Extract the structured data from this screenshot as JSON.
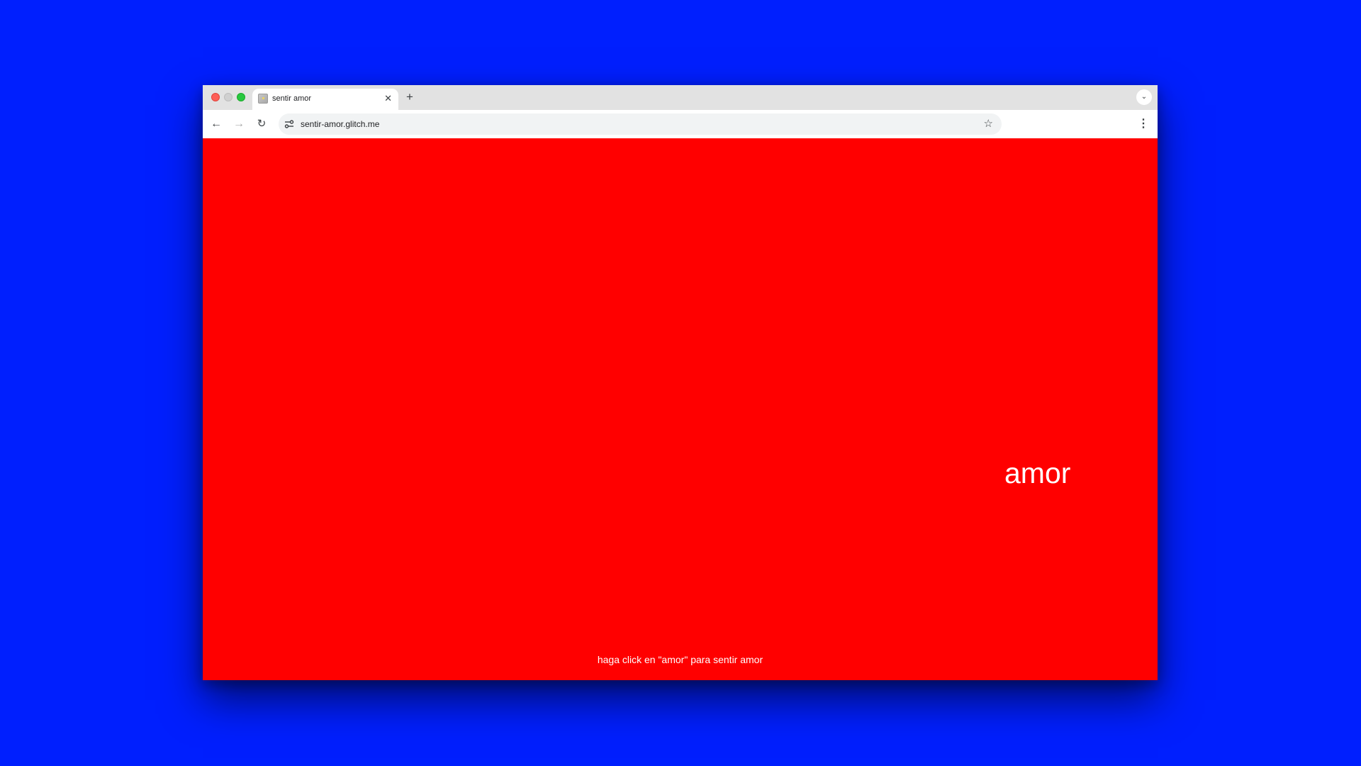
{
  "browser": {
    "tab": {
      "title": "sentir amor",
      "close_glyph": "✕"
    },
    "new_tab_glyph": "+",
    "tab_search_glyph": "⌄",
    "toolbar": {
      "back_glyph": "←",
      "forward_glyph": "→",
      "reload_glyph": "↻",
      "url": "sentir-amor.glitch.me",
      "star_glyph": "☆",
      "menu_glyph": "⋮"
    }
  },
  "page": {
    "link_text": "amor",
    "instructions": "haga click en \"amor\" para sentir amor"
  },
  "colors": {
    "desktop_background": "#001ffe",
    "page_background": "#ff0000",
    "page_text": "#ffffff"
  },
  "icons": [
    "window-close-icon",
    "window-minimize-icon",
    "window-zoom-icon",
    "favicon-icon",
    "tab-close-icon",
    "new-tab-icon",
    "tab-search-icon",
    "back-arrow-icon",
    "forward-arrow-icon",
    "reload-icon",
    "site-info-icon",
    "bookmark-star-icon",
    "kebab-menu-icon"
  ]
}
